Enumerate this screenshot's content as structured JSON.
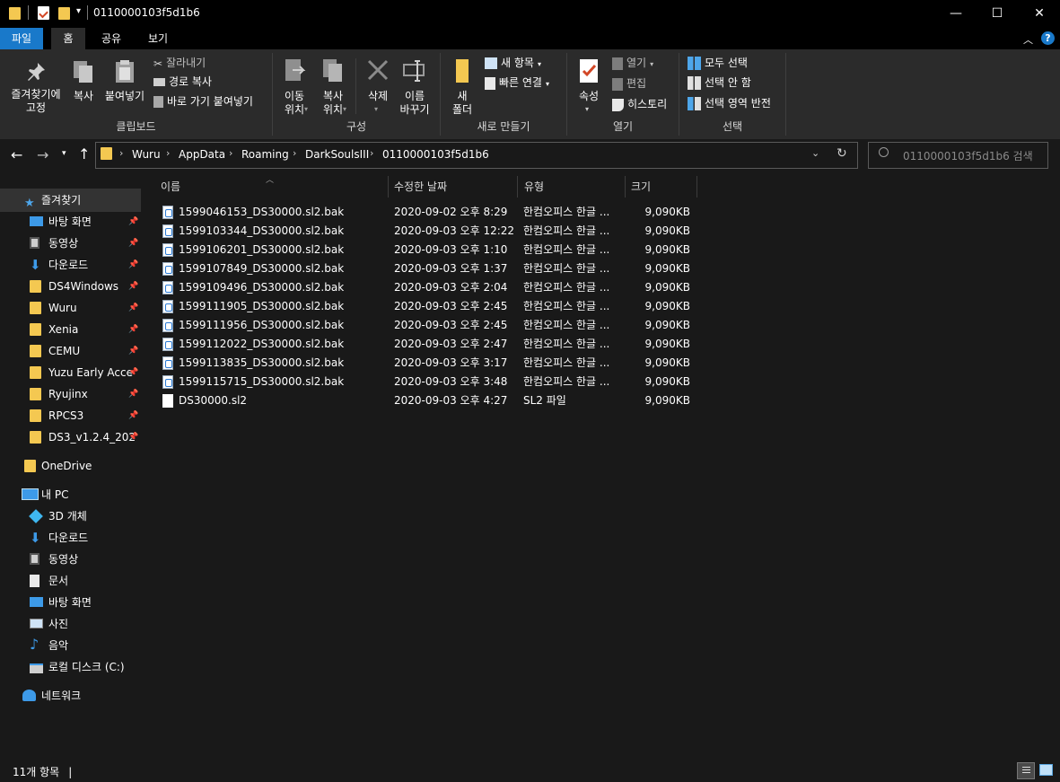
{
  "window": {
    "title": "0110000103f5d1b6",
    "minimize": "—",
    "maximize": "☐",
    "close": "✕"
  },
  "ribbon_tabs": [
    {
      "label": "파일"
    },
    {
      "label": "홈"
    },
    {
      "label": "공유"
    },
    {
      "label": "보기"
    }
  ],
  "ribbon": {
    "clipboard": {
      "pin_label": "즐겨찾기에\n고정",
      "copy_label": "복사",
      "paste_label": "붙여넣기",
      "cut_label": "잘라내기",
      "copy_path_label": "경로 복사",
      "paste_shortcut_label": "바로 가기 붙여넣기",
      "group_label": "클립보드"
    },
    "organize": {
      "move_label": "이동\n위치",
      "copy_to_label": "복사\n위치",
      "delete_label": "삭제",
      "rename_label": "이름\n바꾸기",
      "group_label": "구성"
    },
    "new": {
      "new_folder_label": "새\n폴더",
      "new_item_label": "새 항목",
      "easy_access_label": "빠른 연결",
      "group_label": "새로 만들기"
    },
    "open": {
      "properties_label": "속성",
      "open_label": "열기",
      "edit_label": "편집",
      "history_label": "히스토리",
      "group_label": "열기"
    },
    "select": {
      "select_all_label": "모두 선택",
      "select_none_label": "선택 안 함",
      "invert_label": "선택 영역 반전",
      "group_label": "선택"
    }
  },
  "address": {
    "breadcrumbs": [
      "Wuru",
      "AppData",
      "Roaming",
      "DarkSoulsIII",
      "0110000103f5d1b6"
    ],
    "search_placeholder": "0110000103f5d1b6 검색"
  },
  "nav": {
    "quick_access_label": "즐겨찾기",
    "pinned": [
      {
        "label": "바탕 화면",
        "icon": "desktop-icon"
      },
      {
        "label": "동영상",
        "icon": "videos-icon"
      },
      {
        "label": "다운로드",
        "icon": "download-icon"
      },
      {
        "label": "DS4Windows",
        "icon": "folder-icon"
      },
      {
        "label": "Wuru",
        "icon": "folder-icon"
      },
      {
        "label": "Xenia",
        "icon": "folder-icon"
      },
      {
        "label": "CEMU",
        "icon": "folder-icon"
      },
      {
        "label": "Yuzu Early Acce",
        "icon": "folder-icon"
      },
      {
        "label": "Ryujinx",
        "icon": "folder-icon"
      },
      {
        "label": "RPCS3",
        "icon": "folder-icon"
      },
      {
        "label": "DS3_v1.2.4_202",
        "icon": "folder-icon"
      }
    ],
    "onedrive_label": "OneDrive",
    "this_pc_label": "내 PC",
    "pc_items": [
      {
        "label": "3D 개체",
        "icon": "3d-objects-icon"
      },
      {
        "label": "다운로드",
        "icon": "download-icon"
      },
      {
        "label": "동영상",
        "icon": "videos-icon"
      },
      {
        "label": "문서",
        "icon": "documents-icon"
      },
      {
        "label": "바탕 화면",
        "icon": "desktop-icon"
      },
      {
        "label": "사진",
        "icon": "pictures-icon"
      },
      {
        "label": "음악",
        "icon": "music-icon"
      },
      {
        "label": "로컬 디스크 (C:)",
        "icon": "drive-icon"
      }
    ],
    "network_label": "네트워크"
  },
  "columns": {
    "name": "이름",
    "modified": "수정한 날짜",
    "type": "유형",
    "size": "크기"
  },
  "files": [
    {
      "name": "1599046153_DS30000.sl2.bak",
      "modified": "2020-09-02 오후 8:29",
      "type": "한컴오피스 한글 ...",
      "size": "9,090KB",
      "icon": "hwp-file-icon"
    },
    {
      "name": "1599103344_DS30000.sl2.bak",
      "modified": "2020-09-03 오후 12:22",
      "type": "한컴오피스 한글 ...",
      "size": "9,090KB",
      "icon": "hwp-file-icon"
    },
    {
      "name": "1599106201_DS30000.sl2.bak",
      "modified": "2020-09-03 오후 1:10",
      "type": "한컴오피스 한글 ...",
      "size": "9,090KB",
      "icon": "hwp-file-icon"
    },
    {
      "name": "1599107849_DS30000.sl2.bak",
      "modified": "2020-09-03 오후 1:37",
      "type": "한컴오피스 한글 ...",
      "size": "9,090KB",
      "icon": "hwp-file-icon"
    },
    {
      "name": "1599109496_DS30000.sl2.bak",
      "modified": "2020-09-03 오후 2:04",
      "type": "한컴오피스 한글 ...",
      "size": "9,090KB",
      "icon": "hwp-file-icon"
    },
    {
      "name": "1599111905_DS30000.sl2.bak",
      "modified": "2020-09-03 오후 2:45",
      "type": "한컴오피스 한글 ...",
      "size": "9,090KB",
      "icon": "hwp-file-icon"
    },
    {
      "name": "1599111956_DS30000.sl2.bak",
      "modified": "2020-09-03 오후 2:45",
      "type": "한컴오피스 한글 ...",
      "size": "9,090KB",
      "icon": "hwp-file-icon"
    },
    {
      "name": "1599112022_DS30000.sl2.bak",
      "modified": "2020-09-03 오후 2:47",
      "type": "한컴오피스 한글 ...",
      "size": "9,090KB",
      "icon": "hwp-file-icon"
    },
    {
      "name": "1599113835_DS30000.sl2.bak",
      "modified": "2020-09-03 오후 3:17",
      "type": "한컴오피스 한글 ...",
      "size": "9,090KB",
      "icon": "hwp-file-icon"
    },
    {
      "name": "1599115715_DS30000.sl2.bak",
      "modified": "2020-09-03 오후 3:48",
      "type": "한컴오피스 한글 ...",
      "size": "9,090KB",
      "icon": "hwp-file-icon"
    },
    {
      "name": "DS30000.sl2",
      "modified": "2020-09-03 오후 4:27",
      "type": "SL2 파일",
      "size": "9,090KB",
      "icon": "file-icon"
    }
  ],
  "status": {
    "item_count": "11개 항목"
  },
  "colors": {
    "accent": "#1979ca",
    "background": "#191919",
    "ribbon": "#2b2b2b",
    "folder": "#f4c851"
  }
}
